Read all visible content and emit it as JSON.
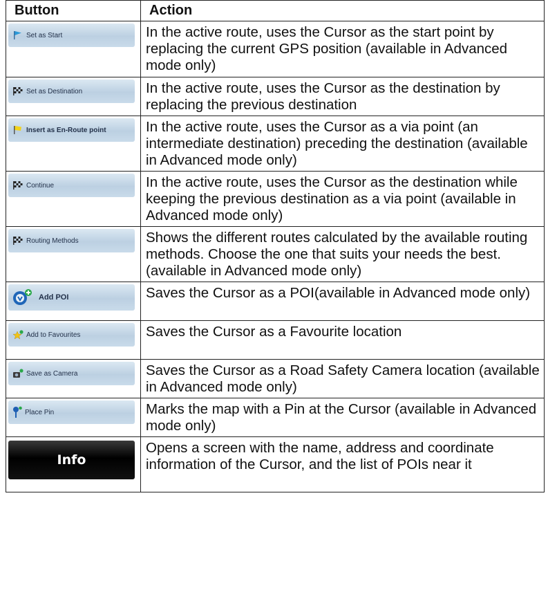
{
  "table": {
    "header": {
      "button": "Button",
      "action": "Action"
    },
    "rows": [
      {
        "button": "Set as Start",
        "icon": "start-flag-icon",
        "action": "In the active route, uses the Cursor as the start point by replacing the current GPS position (available in Advanced mode only)"
      },
      {
        "button": "Set as Destination",
        "icon": "checkered-flag-icon",
        "action": "In the active route, uses the Cursor as the destination by replacing the previous destination"
      },
      {
        "button": "Insert as En-Route point",
        "icon": "yellow-flag-icon",
        "action": "In the active route, uses the Cursor as a via point (an intermediate destination) preceding the destination (available in Advanced mode only)"
      },
      {
        "button": "Continue",
        "icon": "checkered-flag-icon",
        "action": "In the active route, uses the Cursor as the destination while keeping the previous destination as a via point (available in Advanced mode only)"
      },
      {
        "button": "Routing Methods",
        "icon": "checkered-flag-icon",
        "action": "Shows the different routes calculated by the available routing methods. Choose the one that suits your needs the best.(available in Advanced mode only)"
      },
      {
        "button": "Add POI",
        "icon": "add-poi-icon",
        "action": "Saves the Cursor as a POI(available in Advanced mode only)"
      },
      {
        "button": "Add to Favourites",
        "icon": "add-favourite-star-icon",
        "action": "Saves the Cursor as a Favourite location"
      },
      {
        "button": "Save as Camera",
        "icon": "camera-add-icon",
        "action": "Saves the Cursor as a Road Safety Camera location (available in Advanced mode only)"
      },
      {
        "button": "Place Pin",
        "icon": "pin-icon",
        "action": "Marks the map with a Pin at the Cursor (available in Advanced mode only)"
      },
      {
        "button": "Info",
        "icon": "",
        "action": "Opens a screen with the name, address and coordinate information of the Cursor, and the list of POIs near it"
      }
    ]
  },
  "colors": {
    "button_gradient_top": "#dbe8f2",
    "button_gradient_bottom": "#bcd0e2",
    "info_button": "#000000"
  }
}
